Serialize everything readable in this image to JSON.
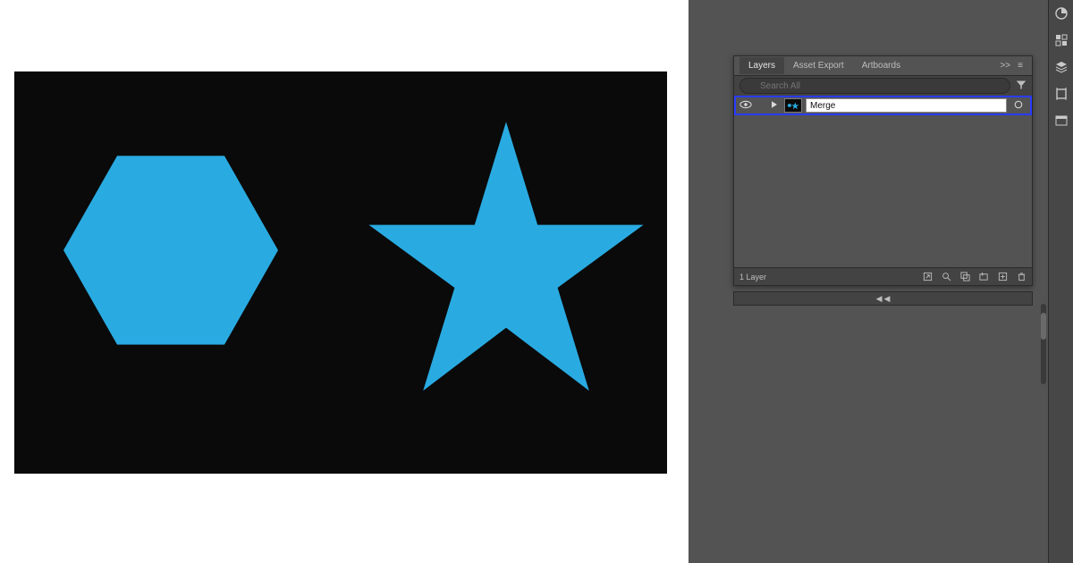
{
  "canvas": {
    "shapes": [
      {
        "type": "hexagon",
        "fill": "#29abe2"
      },
      {
        "type": "star",
        "fill": "#29abe2"
      }
    ],
    "artboard_bg": "#0a0a0a"
  },
  "panel": {
    "tabs": [
      {
        "id": "layers",
        "label": "Layers",
        "active": true
      },
      {
        "id": "asset-export",
        "label": "Asset Export",
        "active": false
      },
      {
        "id": "artboards",
        "label": "Artboards",
        "active": false
      }
    ],
    "more_label": ">>",
    "menu_label": "≡",
    "search_placeholder": "Search All",
    "row": {
      "visibility_icon": "eye-icon",
      "twirl_icon": "chevron-right-icon",
      "thumb_shapes": [
        "hexagon",
        "star"
      ],
      "name": "Merge",
      "target_icon": "circle-target-icon",
      "selected": true
    },
    "footer": {
      "count_label": "1 Layer",
      "icons": [
        "export-icon",
        "locate-icon",
        "clip-mask-icon",
        "new-sublayer-icon",
        "new-layer-icon",
        "trash-icon"
      ]
    }
  },
  "dock_icons": [
    "color-icon",
    "swatches-icon",
    "layers-icon",
    "artboards-icon",
    "libraries-icon"
  ]
}
